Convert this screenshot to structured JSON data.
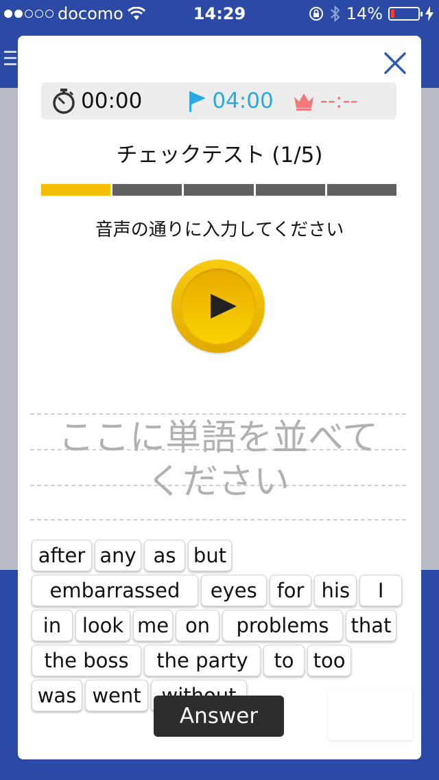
{
  "status_bar": {
    "carrier": "docomo",
    "time": "14:29",
    "battery_percent": "14%",
    "battery_level": 0.14,
    "signal_bars": 2,
    "signal_total": 5
  },
  "timer": {
    "elapsed": "00:00",
    "target": "04:00",
    "best": "--:--",
    "target_color": "#29a9e0",
    "best_color": "#f2787a"
  },
  "title": "チェックテスト (1/5)",
  "progress": {
    "current": 1,
    "total": 5,
    "active_color": "#f6be00",
    "inactive_color": "#606060"
  },
  "instruction": "音声の通りに入力してください",
  "drop_zone": {
    "placeholder_line1": "ここに単語を並べて",
    "placeholder_line2": "ください"
  },
  "word_rows": [
    [
      "after",
      "any",
      "as",
      "but"
    ],
    [
      "embarrassed",
      "eyes",
      "for",
      "his",
      "I"
    ],
    [
      "in",
      "look",
      "me",
      "on",
      "problems",
      "that"
    ],
    [
      "the boss",
      "the party",
      "to",
      "too"
    ],
    [
      "was",
      "went",
      "without"
    ]
  ],
  "answer_button": "Answer",
  "icons": {
    "close": "close-icon",
    "stopwatch": "stopwatch-icon",
    "flag": "flag-icon",
    "crown": "crown-icon",
    "play": "play-icon"
  }
}
